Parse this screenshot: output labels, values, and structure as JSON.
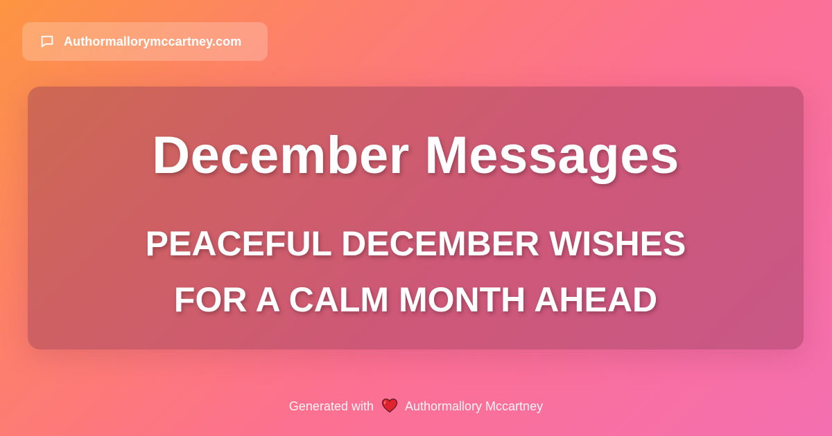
{
  "badge": {
    "icon": "chat-bubble-icon",
    "domain": "Authormallorymccartney.com"
  },
  "card": {
    "title": "December Messages",
    "subtitle_lines": [
      "PEACEFUL DECEMBER WISHES",
      "FOR A CALM MONTH AHEAD"
    ]
  },
  "footer": {
    "prefix": "Generated with",
    "icon": "heart-icon",
    "author": "Authormallory Mccartney"
  },
  "colors": {
    "background_start": "#fd9542",
    "background_end": "#f46fb0",
    "card_overlay": "#8c3755",
    "text": "#ffffff",
    "heart": "#e0242f"
  }
}
